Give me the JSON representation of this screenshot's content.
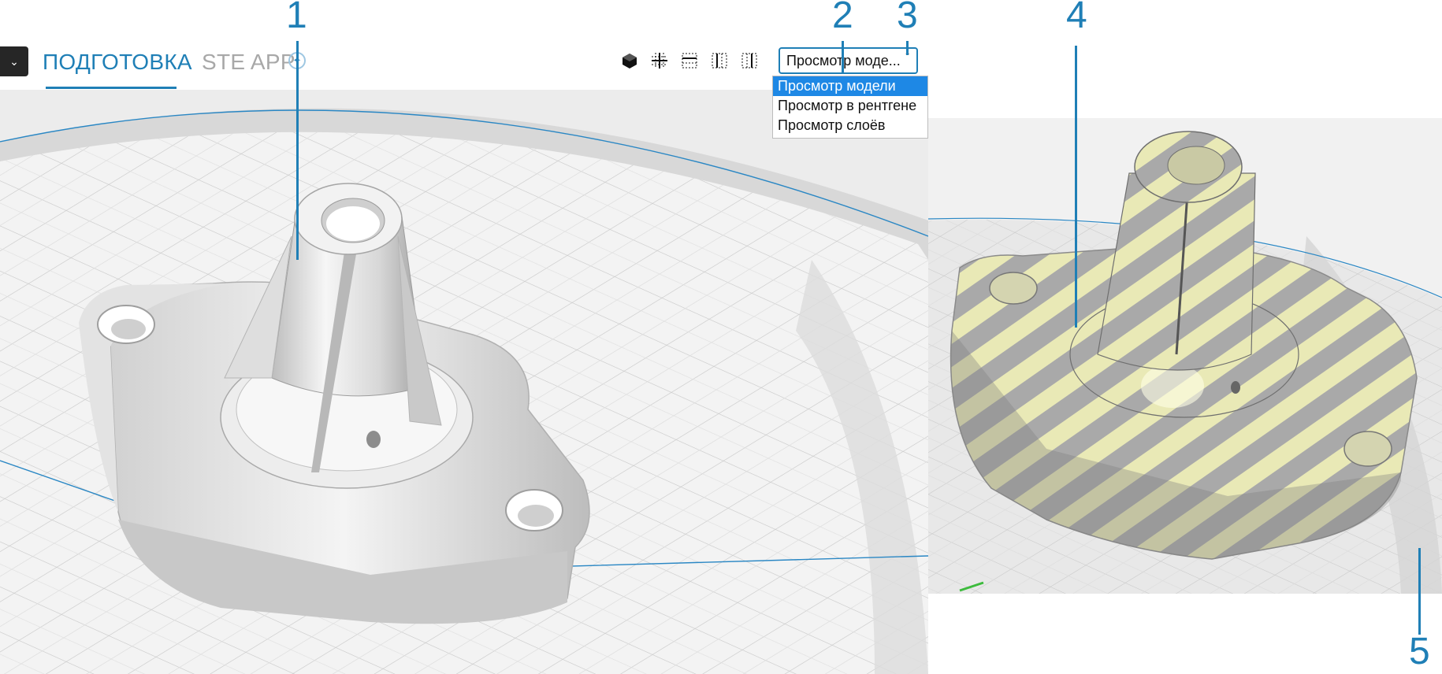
{
  "tabs": {
    "prepare": "ПОДГОТОВКА",
    "ste_app": "STE APP"
  },
  "view_icons": [
    "solid-view-icon",
    "front-view-icon",
    "top-view-icon",
    "left-view-icon",
    "right-view-icon"
  ],
  "view_mode": {
    "selected_label": "Просмотр моде...",
    "options": [
      "Просмотр модели",
      "Просмотр в рентгене",
      "Просмотр слоёв"
    ],
    "selected_index": 0
  },
  "callouts": [
    "1",
    "2",
    "3",
    "4",
    "5"
  ],
  "colors": {
    "accent": "#1f7fb6",
    "selected_option": "#1e88e5",
    "toolbar_dark": "#262626",
    "xray_stripe": "#e9e9b6"
  }
}
